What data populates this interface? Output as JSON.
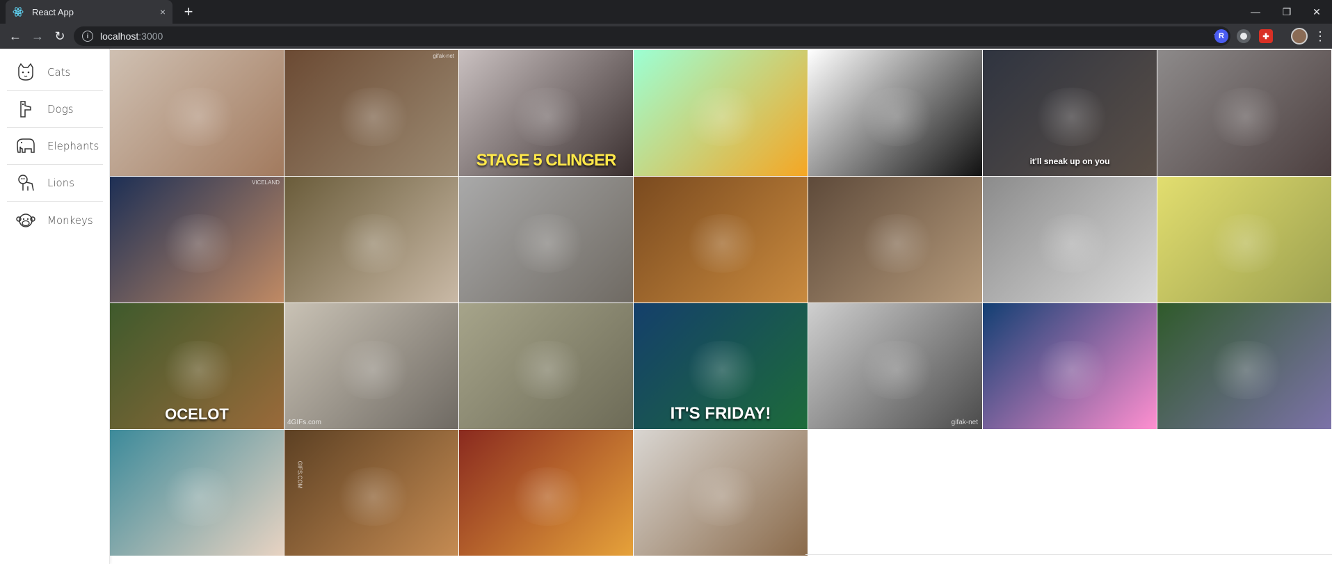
{
  "browser": {
    "tab_title": "React App",
    "tab_close": "×",
    "new_tab": "+",
    "url_host": "localhost",
    "url_port": ":3000",
    "back_icon": "←",
    "forward_icon": "→",
    "reload_icon": "↻",
    "star_icon": "☆",
    "menu_icon": "⋮",
    "minimize": "—",
    "restore": "❐",
    "close": "✕"
  },
  "sidebar": {
    "items": [
      {
        "label": "Cats",
        "icon": "cat-icon"
      },
      {
        "label": "Dogs",
        "icon": "dog-icon"
      },
      {
        "label": "Elephants",
        "icon": "elephant-icon"
      },
      {
        "label": "Lions",
        "icon": "lion-icon"
      },
      {
        "label": "Monkeys",
        "icon": "monkey-icon"
      }
    ]
  },
  "gallery": {
    "tiles": [
      {
        "name": "gif-cat-shower",
        "caption": "",
        "corner": "",
        "colors": [
          "#cfc0b2",
          "#a27a5e"
        ]
      },
      {
        "name": "gif-cats-wrestling",
        "caption": "",
        "corner": "gifak-net",
        "colors": [
          "#6b4a33",
          "#9c8a72"
        ]
      },
      {
        "name": "gif-stage-5-clinger",
        "caption": "STAGE 5 CLINGER",
        "corner": "",
        "colors": [
          "#c9c0c0",
          "#3a2f2f"
        ]
      },
      {
        "name": "gif-cartoon-tiger-cat",
        "caption": "",
        "corner": "",
        "colors": [
          "#9cffd4",
          "#f5a623"
        ]
      },
      {
        "name": "gif-kit-cat-clock",
        "caption": "",
        "corner": "",
        "colors": [
          "#ffffff",
          "#111111"
        ]
      },
      {
        "name": "gif-cat-sneak",
        "caption": "it'll sneak up on you",
        "corner": "",
        "colors": [
          "#2f3440",
          "#5a4f47"
        ]
      },
      {
        "name": "gif-cat-dog-garden",
        "caption": "",
        "corner": "",
        "colors": [
          "#8d8a8a",
          "#4d4040"
        ]
      },
      {
        "name": "gif-kitten-syringe",
        "caption": "",
        "corner": "VICELAND",
        "colors": [
          "#1d2f55",
          "#c08a64"
        ]
      },
      {
        "name": "gif-kittens-carpet",
        "caption": "",
        "corner": "",
        "colors": [
          "#6a5c3a",
          "#c9b9a6"
        ]
      },
      {
        "name": "gif-flying-cat",
        "caption": "",
        "corner": "",
        "colors": [
          "#a9a9a9",
          "#6f6a63"
        ]
      },
      {
        "name": "gif-orange-cat-rolling",
        "caption": "",
        "corner": "",
        "colors": [
          "#7a4a1f",
          "#c98a3e"
        ]
      },
      {
        "name": "gif-bengal-cats",
        "caption": "",
        "corner": "",
        "colors": [
          "#5e4a3a",
          "#b59a7b"
        ]
      },
      {
        "name": "gif-cat-faucet",
        "caption": "",
        "corner": "",
        "colors": [
          "#8b8b8b",
          "#d9d9d9"
        ]
      },
      {
        "name": "gif-cat-towel-massage",
        "caption": "",
        "corner": "",
        "colors": [
          "#e2de6f",
          "#9ca04f"
        ]
      },
      {
        "name": "gif-ocelot",
        "caption": "OCELOT",
        "corner": "",
        "colors": [
          "#3e5a2c",
          "#9a6a3a"
        ]
      },
      {
        "name": "gif-kittens-hug",
        "caption": "",
        "corner": "4GIFs.com",
        "colors": [
          "#c9c2b5",
          "#6f6a63"
        ]
      },
      {
        "name": "gif-cat-flat",
        "caption": "",
        "corner": "",
        "colors": [
          "#a6a48a",
          "#6d6b57"
        ]
      },
      {
        "name": "gif-its-friday",
        "caption": "IT'S FRIDAY!",
        "corner": "",
        "colors": [
          "#143f6b",
          "#1d6b3a"
        ]
      },
      {
        "name": "gif-cats-cuddling",
        "caption": "",
        "corner": "gifak-net",
        "colors": [
          "#cfcfcf",
          "#4b4b4b"
        ]
      },
      {
        "name": "gif-nyan-cat",
        "caption": "",
        "corner": "",
        "colors": [
          "#123f73",
          "#ff8fd0"
        ]
      },
      {
        "name": "gif-cat-pillow",
        "caption": "",
        "corner": "",
        "colors": [
          "#2f5a2a",
          "#7c72a8"
        ]
      },
      {
        "name": "gif-singer-kitten",
        "caption": "",
        "corner": "",
        "colors": [
          "#3c8a9a",
          "#e8d3c2"
        ]
      },
      {
        "name": "gif-cats-sleeping",
        "caption": "",
        "corner": "GIFS.COM",
        "colors": [
          "#5c4023",
          "#c58b52"
        ]
      },
      {
        "name": "gif-cartoon-cat-chair",
        "caption": "",
        "corner": "",
        "colors": [
          "#8a2a1f",
          "#e6a23a"
        ]
      },
      {
        "name": "gif-tiger-cub",
        "caption": "",
        "corner": "",
        "colors": [
          "#d9d6d2",
          "#8a6a4a"
        ]
      }
    ]
  }
}
